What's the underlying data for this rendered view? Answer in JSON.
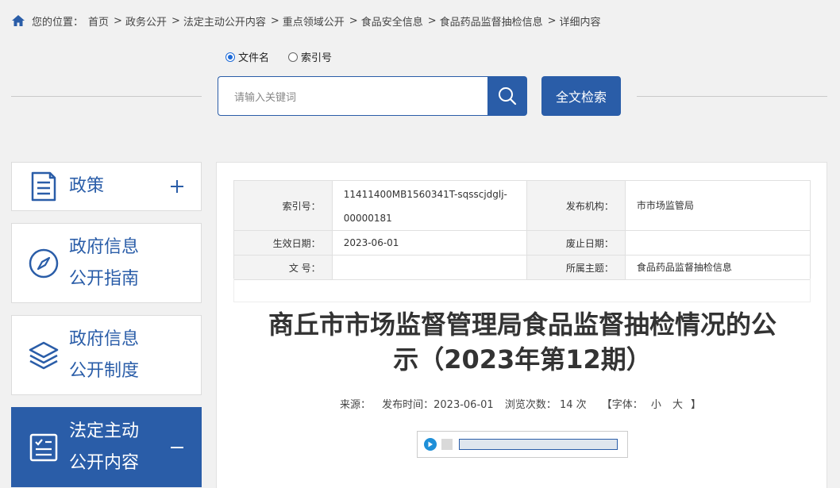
{
  "breadcrumb": {
    "label": "您的位置：",
    "items": [
      "首页",
      "政务公开",
      "法定主动公开内容",
      "重点领域公开",
      "食品安全信息",
      "食品药品监督抽检信息",
      "详细内容"
    ],
    "separator": ">"
  },
  "search": {
    "radio_options": [
      "文件名",
      "索引号"
    ],
    "selected": "文件名",
    "placeholder": "请输入关键词",
    "fulltext_label": "全文检索"
  },
  "sidebar": {
    "items": [
      {
        "lines": [
          "政策"
        ],
        "icon": "document-icon",
        "toggle": "+",
        "active": false
      },
      {
        "lines": [
          "政府信息",
          "公开指南"
        ],
        "icon": "compass-icon",
        "toggle": "",
        "active": false
      },
      {
        "lines": [
          "政府信息",
          "公开制度"
        ],
        "icon": "layers-icon",
        "toggle": "",
        "active": false
      },
      {
        "lines": [
          "法定主动",
          "公开内容"
        ],
        "icon": "checklist-icon",
        "toggle": "−",
        "active": true
      }
    ]
  },
  "meta": {
    "index_no_label": "索引号：",
    "index_no_line1": "11411400MB1560341T-sqsscjdglj-",
    "index_no_line2": "00000181",
    "publisher_label": "发布机构：",
    "publisher": "市市场监管局",
    "effective_label": "生效日期：",
    "effective": "2023-06-01",
    "repeal_label": "废止日期：",
    "repeal": "",
    "doc_no_label": "文 号：",
    "doc_no": "",
    "topic_label": "所属主题：",
    "topic": "食品药品监督抽检信息"
  },
  "article": {
    "title_line1": "商丘市市场监督管理局食品监督抽检情况的公",
    "title_line2": "示（2023年第12期）",
    "source_label": "来源：",
    "publish_time": "发布时间：2023-06-01",
    "views": "浏览次数： 14  次",
    "font_label": "【字体：",
    "font_small": "小",
    "font_large": "大",
    "font_end": "】"
  },
  "player": {
    "progress": 0
  },
  "colors": {
    "primary": "#2a5da8",
    "background": "#f1f1f1"
  }
}
